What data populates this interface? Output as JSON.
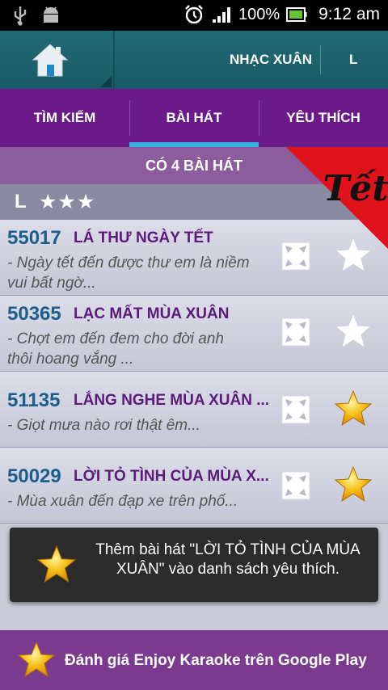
{
  "status_bar": {
    "left_icons": [
      "usb-icon",
      "android-debug-icon"
    ],
    "right_icons": [
      "alarm-icon",
      "signal-icon",
      "battery-icon"
    ],
    "battery": "100%",
    "time": "9:12 am"
  },
  "app_bar": {
    "home_icon": "home-icon",
    "title": "NHẠC XUÂN",
    "letter": "L"
  },
  "tabs": [
    {
      "label": "TÌM KIẾM"
    },
    {
      "label": "BÀI HÁT"
    },
    {
      "label": "YÊU THÍCH"
    }
  ],
  "selected_tab": "BÀI HÁT",
  "song_count": "CÓ 4 BÀI HÁT",
  "tet_badge": {
    "text": "Tết"
  },
  "group": {
    "letter": "L",
    "stars": "★★★"
  },
  "songs": [
    {
      "code": "55017",
      "title": "LÁ THƯ NGÀY TẾT",
      "lyric": "- Ngày tết đến được thư em là niềm\nvui bất ngờ...",
      "favorite": false
    },
    {
      "code": "50365",
      "title": "LẠC MẤT MÙA XUÂN",
      "lyric": "- Chợt em đến đem cho đời anh\nthôi hoang vắng ...",
      "favorite": false
    },
    {
      "code": "51135",
      "title": "LẮNG NGHE MÙA XUÂN ...",
      "lyric": "- Giọt mưa nào rơi thật êm...",
      "favorite": true
    },
    {
      "code": "50029",
      "title": "LỜI TỎ TÌNH CỦA MÙA X...",
      "lyric": "- Mùa xuân đến đạp xe trên phố...",
      "favorite": true
    }
  ],
  "toast": {
    "text": "Thêm bài hát \"LỜI TỎ TÌNH CỦA MÙA XUÂN\" vào danh sách yêu thích."
  },
  "rate_bar": {
    "text": "Đánh giá Enjoy Karaoke trên Google Play"
  },
  "colors": {
    "app_bar": "#1f6470",
    "tab_bar": "#6b1a8a",
    "tab_indicator": "#37b0e3",
    "song_code": "#1b5e8c",
    "song_title": "#5b1a7c",
    "gold_star": "#f4b81a"
  }
}
